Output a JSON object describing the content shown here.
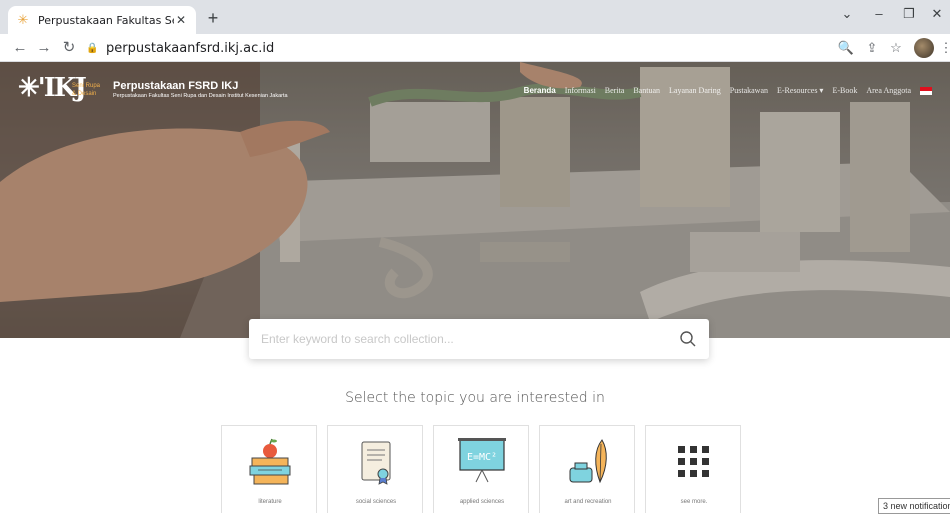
{
  "browser": {
    "tab_title": "Perpustakaan Fakultas Seni Rupa",
    "url": "perpustakaanfsrd.ikj.ac.id"
  },
  "site": {
    "logo_text": "✳'IKJ",
    "logo_sub_1": "Seni Rupa",
    "logo_sub_2": "& Desain",
    "title": "Perpustakaan FSRD IKJ",
    "subtitle": "Perpustakaan Fakultas Seni Rupa dan Desain Institut Kesenian Jakarta"
  },
  "nav": {
    "items": [
      "Beranda",
      "Informasi",
      "Berita",
      "Bantuan",
      "Layanan Daring",
      "Pustakawan",
      "E-Resources ▾",
      "E-Book",
      "Area Anggota"
    ]
  },
  "search": {
    "placeholder": "Enter keyword to search collection..."
  },
  "topics": {
    "heading": "Select the topic you are interested in",
    "items": [
      {
        "label": "literature",
        "icon": "books-apple-icon"
      },
      {
        "label": "social sciences",
        "icon": "certificate-icon"
      },
      {
        "label": "applied sciences",
        "icon": "blackboard-emc2-icon"
      },
      {
        "label": "art and recreation",
        "icon": "ink-quill-icon"
      },
      {
        "label": "see more.",
        "icon": "grid-dots-icon"
      }
    ]
  },
  "notification": {
    "text": "3 new notification"
  },
  "colors": {
    "accent": "#f1b04b",
    "icon_teal": "#7fd3df"
  }
}
